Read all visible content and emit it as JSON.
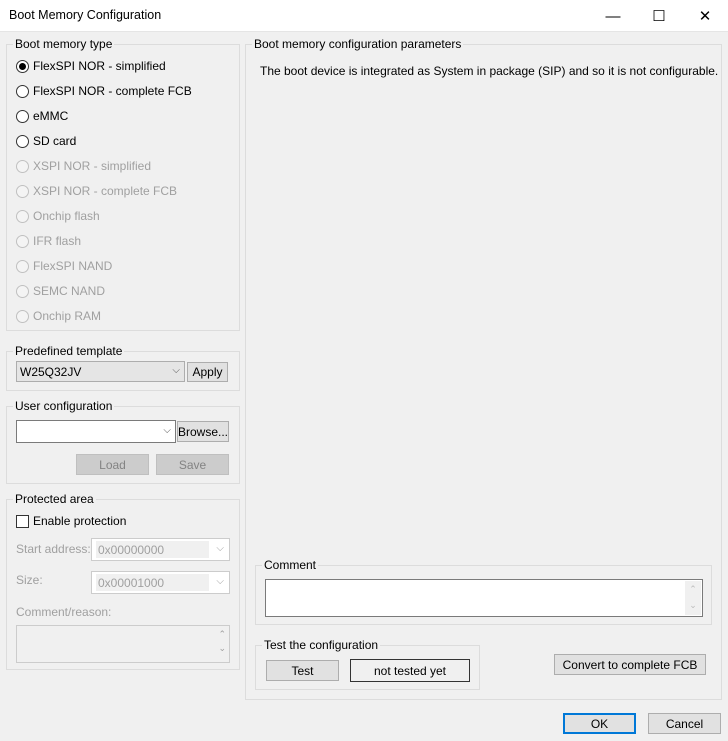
{
  "window": {
    "title": "Boot Memory Configuration",
    "minimize": "—",
    "maximize": "☐",
    "close": "✕"
  },
  "boot_memory_type": {
    "label": "Boot memory type",
    "options": [
      {
        "label": "FlexSPI NOR - simplified",
        "selected": true,
        "enabled": true
      },
      {
        "label": "FlexSPI NOR - complete FCB",
        "selected": false,
        "enabled": true
      },
      {
        "label": "eMMC",
        "selected": false,
        "enabled": true
      },
      {
        "label": "SD card",
        "selected": false,
        "enabled": true
      },
      {
        "label": "XSPI NOR - simplified",
        "selected": false,
        "enabled": false
      },
      {
        "label": "XSPI NOR - complete FCB",
        "selected": false,
        "enabled": false
      },
      {
        "label": "Onchip flash",
        "selected": false,
        "enabled": false
      },
      {
        "label": "IFR flash",
        "selected": false,
        "enabled": false
      },
      {
        "label": "FlexSPI NAND",
        "selected": false,
        "enabled": false
      },
      {
        "label": "SEMC NAND",
        "selected": false,
        "enabled": false
      },
      {
        "label": "Onchip RAM",
        "selected": false,
        "enabled": false
      }
    ]
  },
  "predefined_template": {
    "label": "Predefined template",
    "value": "W25Q32JV",
    "apply": "Apply"
  },
  "user_configuration": {
    "label": "User configuration",
    "value": "",
    "browse": "Browse...",
    "load": "Load",
    "save": "Save"
  },
  "protected_area": {
    "label": "Protected area",
    "enable": "Enable protection",
    "start_label": "Start address:",
    "start_value": "0x00000000",
    "size_label": "Size:",
    "size_value": "0x00001000",
    "comment_label": "Comment/reason:"
  },
  "parameters": {
    "label": "Boot memory configuration parameters",
    "message": "The boot device is integrated as System in package (SIP) and so it is not configurable."
  },
  "comment": {
    "label": "Comment",
    "value": ""
  },
  "test": {
    "label": "Test the configuration",
    "test_button": "Test",
    "status": "not tested yet"
  },
  "convert": "Convert to complete FCB",
  "ok": "OK",
  "cancel": "Cancel"
}
